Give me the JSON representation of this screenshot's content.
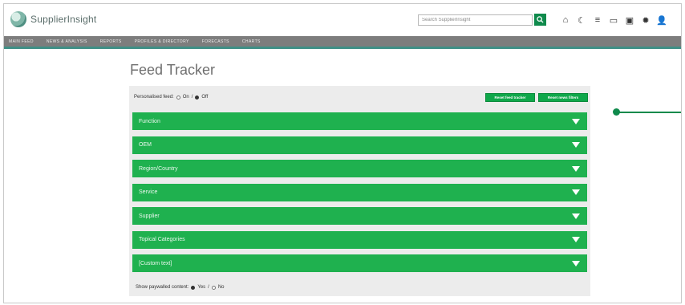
{
  "app": {
    "name": "SupplierInsight"
  },
  "search": {
    "placeholder": "Search SupplierInsight"
  },
  "header_icons": [
    {
      "name": "home-icon",
      "glyph": "⌂"
    },
    {
      "name": "moon-icon",
      "glyph": "☾"
    },
    {
      "name": "menu-icon",
      "glyph": "≡"
    },
    {
      "name": "tablet-icon",
      "glyph": "▭"
    },
    {
      "name": "chart-icon",
      "glyph": "▣"
    },
    {
      "name": "gear-icon",
      "glyph": "✹"
    },
    {
      "name": "user-icon",
      "glyph": "👤"
    }
  ],
  "nav": {
    "items": [
      "MAIN FEED",
      "NEWS & ANALYSIS",
      "REPORTS",
      "PROFILES & DIRECTORY",
      "FORECASTS",
      "CHARTS"
    ]
  },
  "page": {
    "title": "Feed Tracker"
  },
  "personalised": {
    "label": "Personalised feed:",
    "options": [
      "On",
      "Off"
    ],
    "selected": "Off"
  },
  "buttons": {
    "reset_feed_tracker": "Reset feed tracker",
    "reset_news_filters": "Reset news filters"
  },
  "filters": [
    "Function",
    "OEM",
    "Region/Country",
    "Service",
    "Supplier",
    "Topical Categories",
    "[Custom text]"
  ],
  "show_paywalled": {
    "label": "Show paywalled content:",
    "options": [
      "Yes",
      "No"
    ],
    "selected": "Yes"
  },
  "colors": {
    "accent_green": "#1fb14f",
    "dark_green": "#0f8a4c",
    "nav_gray": "#7d7d7d",
    "teal_rule": "#3f8f86"
  }
}
